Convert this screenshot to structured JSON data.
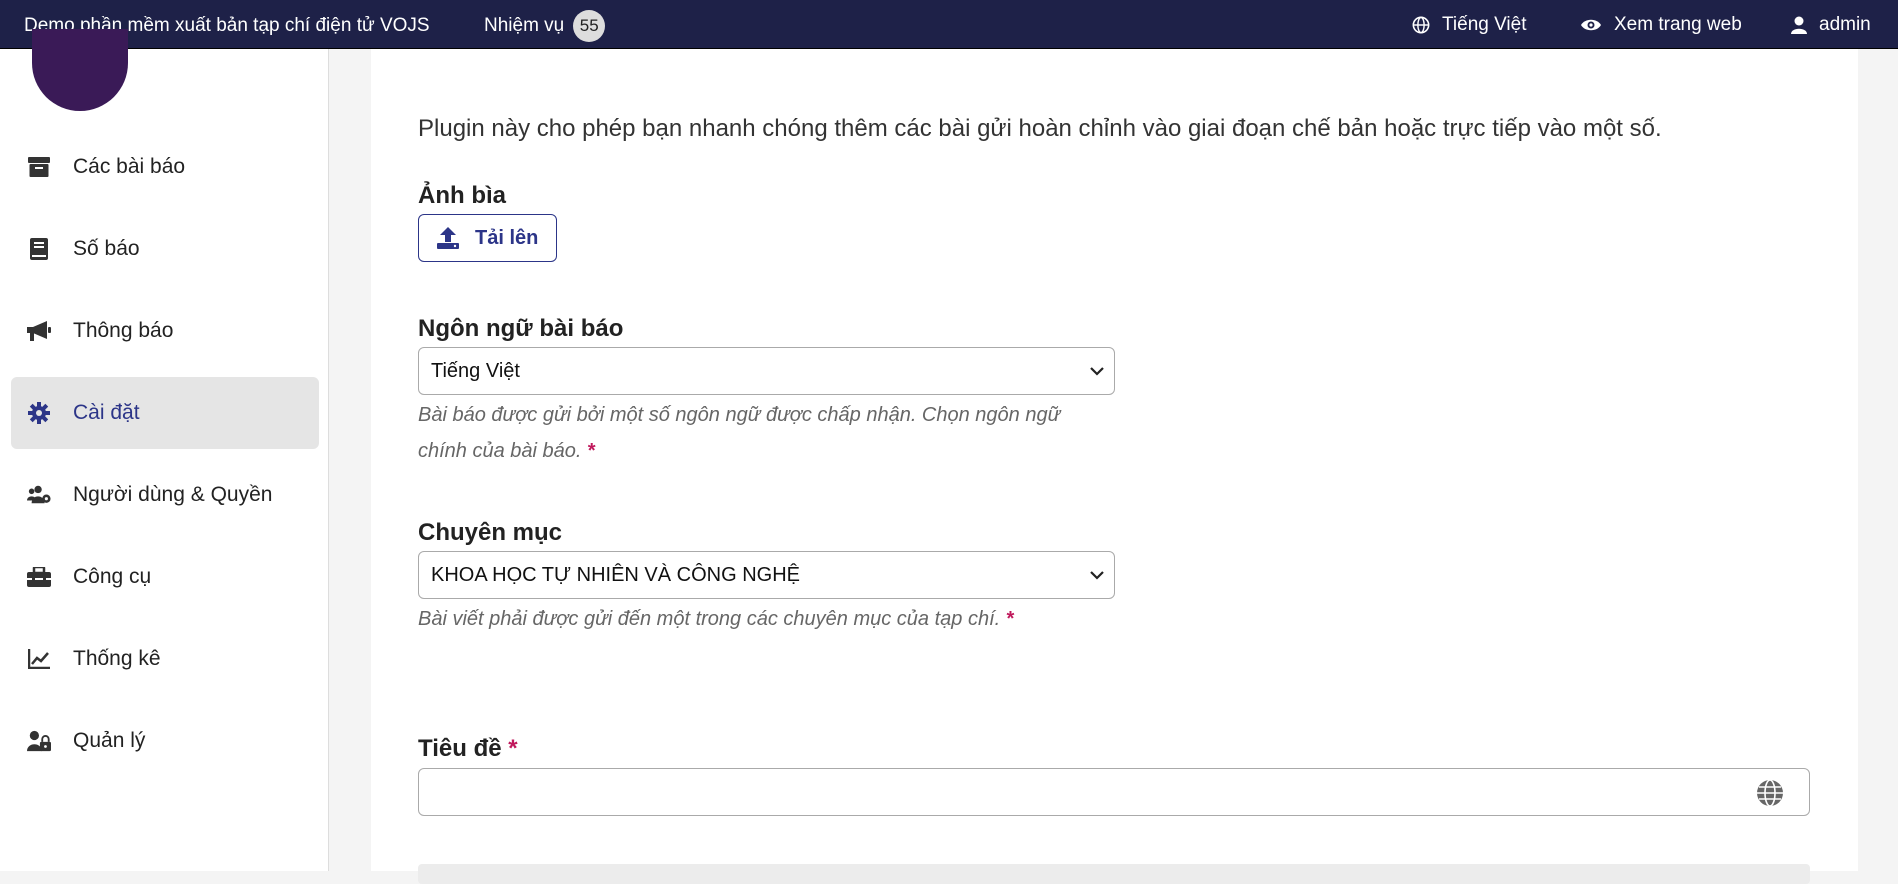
{
  "topbar": {
    "app_title": "Demo phần mềm xuất bản tạp chí điện tử VOJS",
    "tasks_label": "Nhiệm vụ",
    "tasks_count": "55",
    "language": "Tiếng Việt",
    "view_site": "Xem trang web",
    "user": "admin"
  },
  "sidebar": {
    "items": [
      {
        "label": "Các bài báo",
        "icon": "archive-icon"
      },
      {
        "label": "Số báo",
        "icon": "book-icon"
      },
      {
        "label": "Thông báo",
        "icon": "megaphone-icon"
      },
      {
        "label": "Cài đặt",
        "icon": "gear-icon",
        "active": true
      },
      {
        "label": "Người dùng & Quyền",
        "icon": "users-gear-icon"
      },
      {
        "label": "Công cụ",
        "icon": "toolbox-icon"
      },
      {
        "label": "Thống kê",
        "icon": "line-chart-icon"
      },
      {
        "label": "Quản lý",
        "icon": "user-lock-icon"
      }
    ]
  },
  "main": {
    "intro": "Plugin này cho phép bạn nhanh chóng thêm các bài gửi hoàn chỉnh vào giai đoạn chế bản hoặc trực tiếp vào một số.",
    "cover_label": "Ảnh bìa",
    "upload_label": "Tải lên",
    "language_label": "Ngôn ngữ bài báo",
    "language_value": "Tiếng Việt",
    "language_help": "Bài báo được gửi bởi một số ngôn ngữ được chấp nhận. Chọn ngôn ngữ chính của bài báo.",
    "section_label": "Chuyên mục",
    "section_value": "KHOA HỌC TỰ NHIÊN VÀ CÔNG NGHỆ",
    "section_help": "Bài viết phải được gửi đến một trong các chuyên mục của tạp chí.",
    "title_label": "Tiêu đề",
    "required_mark": "*"
  },
  "colors": {
    "topbar_bg": "#1e2148",
    "accent": "#2c3588",
    "required": "#c0195c"
  }
}
